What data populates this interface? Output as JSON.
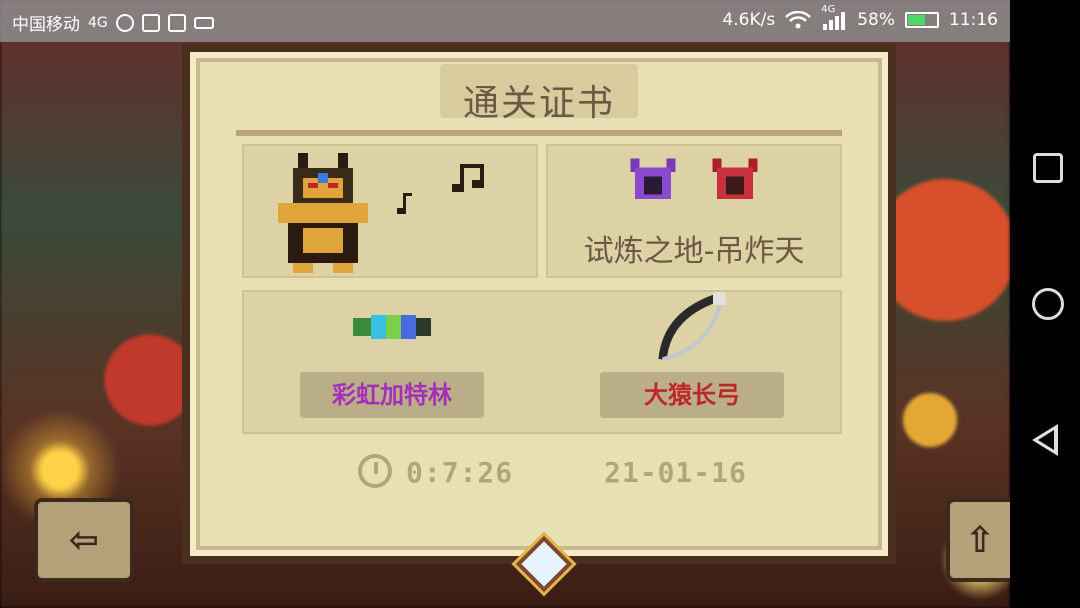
{
  "status_bar": {
    "carrier": "中国移动",
    "network": "4G",
    "speed": "4.6K/s",
    "signal_label": "4G",
    "battery_percent": "58%",
    "battery_level": 0.58,
    "time": "11:16"
  },
  "certificate": {
    "title": "通关证书",
    "stage_name": "试炼之地-吊炸天",
    "weapons": [
      {
        "name": "彩虹加特林",
        "color": "#a52fb8"
      },
      {
        "name": "大猿长弓",
        "color": "#c0252a"
      }
    ],
    "time_elapsed": "0:7:26",
    "date": "21-01-16"
  },
  "buttons": {
    "exit_glyph": "⇦",
    "share_glyph": "⇧"
  }
}
